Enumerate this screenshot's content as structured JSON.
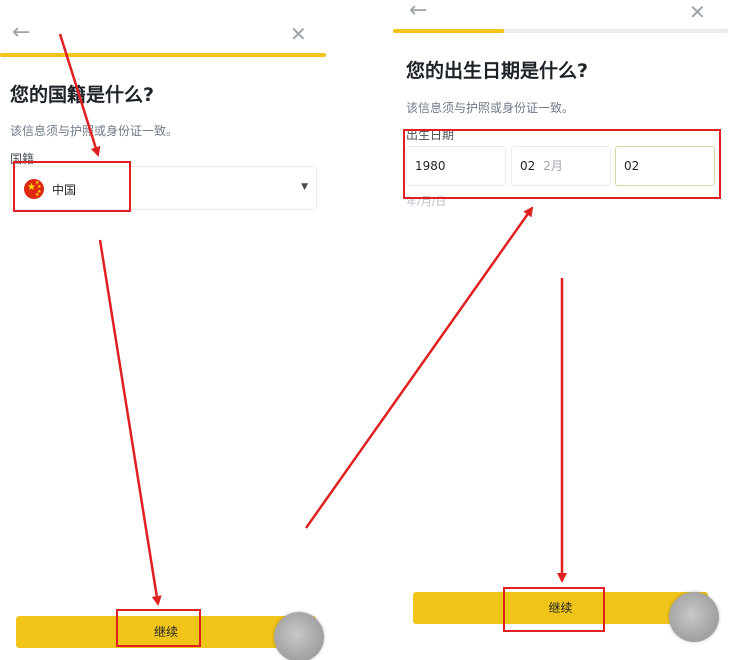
{
  "left_screen": {
    "back_icon": "←",
    "close_icon": "✕",
    "progress_fraction": 1.0,
    "title": "您的国籍是什么?",
    "subtitle": "该信息须与护照或身份证一致。",
    "field_label": "国籍",
    "nationality": {
      "flag_icon": "china-flag-icon",
      "value": "中国",
      "caret": "▼"
    },
    "continue_label": "继续"
  },
  "right_screen": {
    "back_icon": "←",
    "close_icon": "✕",
    "progress_fraction": 0.33,
    "title": "您的出生日期是什么?",
    "subtitle": "该信息须与护照或身份证一致。",
    "field_label": "出生日期",
    "date": {
      "year": "1980",
      "month": "02",
      "month_hint": "2月",
      "day": "02",
      "format_hint": "年/月/日"
    },
    "continue_label": "继续"
  },
  "colors": {
    "accent_yellow": "#f0c419",
    "annotation_red": "#e02020"
  }
}
